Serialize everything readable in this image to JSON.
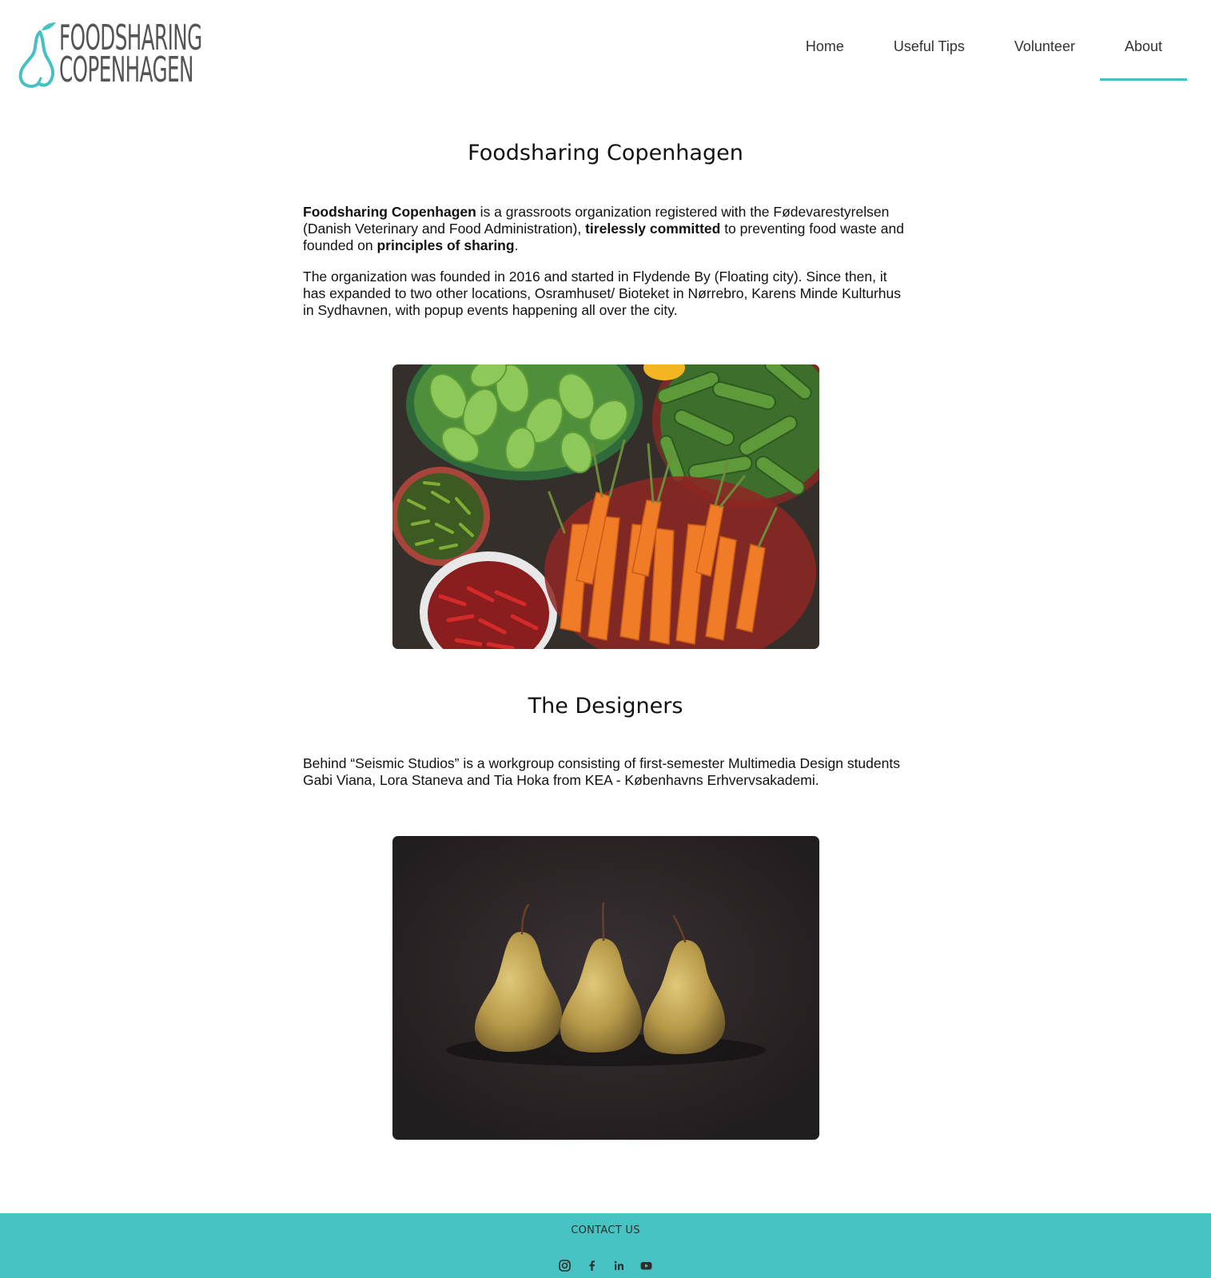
{
  "header": {
    "logo": {
      "line1": "FOODSHARING",
      "line2": "COPENHAGEN"
    },
    "nav": [
      {
        "label": "Home",
        "active": false
      },
      {
        "label": "Useful Tips",
        "active": false
      },
      {
        "label": "Volunteer",
        "active": false
      },
      {
        "label": "About",
        "active": true
      }
    ]
  },
  "about": {
    "title": "Foodsharing Copenhagen",
    "p1": {
      "b1": "Foodsharing Copenhagen",
      "t1": " is a grassroots organization registered with the Fødevarestyrelsen (Danish Veterinary and Food Administration), ",
      "b2": "tirelessly committed",
      "t2": " to preventing food waste and founded on ",
      "b3": "principles of sharing",
      "t3": "."
    },
    "p2": "The organization was founded in 2016 and started in Flydende By (Floating city). Since then, it has expanded to two other locations, Osramhuset/ Bioteket in Nørrebro, Karens Minde Kulturhus in Sydhavnen, with popup events happening all over the city.",
    "image": "market-vegetables-photo"
  },
  "designers": {
    "title": "The Designers",
    "p1": "Behind “Seismic Studios” is a workgroup consisting of first-semester Multimedia Design students Gabi Viana, Lora Staneva and Tia Hoka from KEA - Københavns Erhvervsakademi.",
    "image": "three-pears-photo"
  },
  "footer": {
    "title": "CONTACT US",
    "socials": [
      "instagram-icon",
      "facebook-icon",
      "linkedin-icon",
      "youtube-icon"
    ]
  },
  "colors": {
    "accent": "#47c0c1",
    "footer_bg": "#47c3c3",
    "text": "#111111",
    "nav_text": "#333333"
  }
}
